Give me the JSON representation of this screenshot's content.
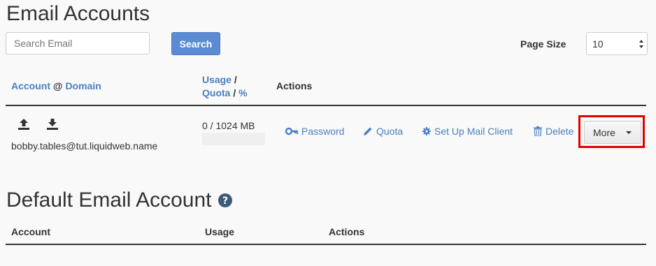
{
  "page": {
    "title": "Email Accounts"
  },
  "search": {
    "placeholder": "Search Email",
    "button_label": "Search"
  },
  "page_size": {
    "label": "Page Size",
    "value": "10"
  },
  "table": {
    "headers": {
      "account": "Account",
      "at": " @ ",
      "domain": "Domain",
      "usage": "Usage",
      "slash1": " /",
      "quota": "Quota",
      "slash2": " / ",
      "percent": "%",
      "actions": "Actions"
    },
    "rows": [
      {
        "email": "bobby.tables@tut.liquidweb.name",
        "usage": "0 / 1024 MB",
        "usage_fraction": 0,
        "actions": {
          "password": "Password",
          "quota": "Quota",
          "setup": "Set Up Mail Client",
          "delete": "Delete",
          "more": "More"
        }
      }
    ]
  },
  "default_account": {
    "title": "Default Email Account",
    "headers": {
      "account": "Account",
      "usage": "Usage",
      "actions": "Actions"
    }
  },
  "colors": {
    "link": "#4a7fc1",
    "primary_button": "#5b8bd3",
    "highlight": "#e00000"
  },
  "icons": [
    "upload-icon",
    "download-icon",
    "key-icon",
    "pencil-icon",
    "gear-icon",
    "trash-icon",
    "question-icon"
  ]
}
